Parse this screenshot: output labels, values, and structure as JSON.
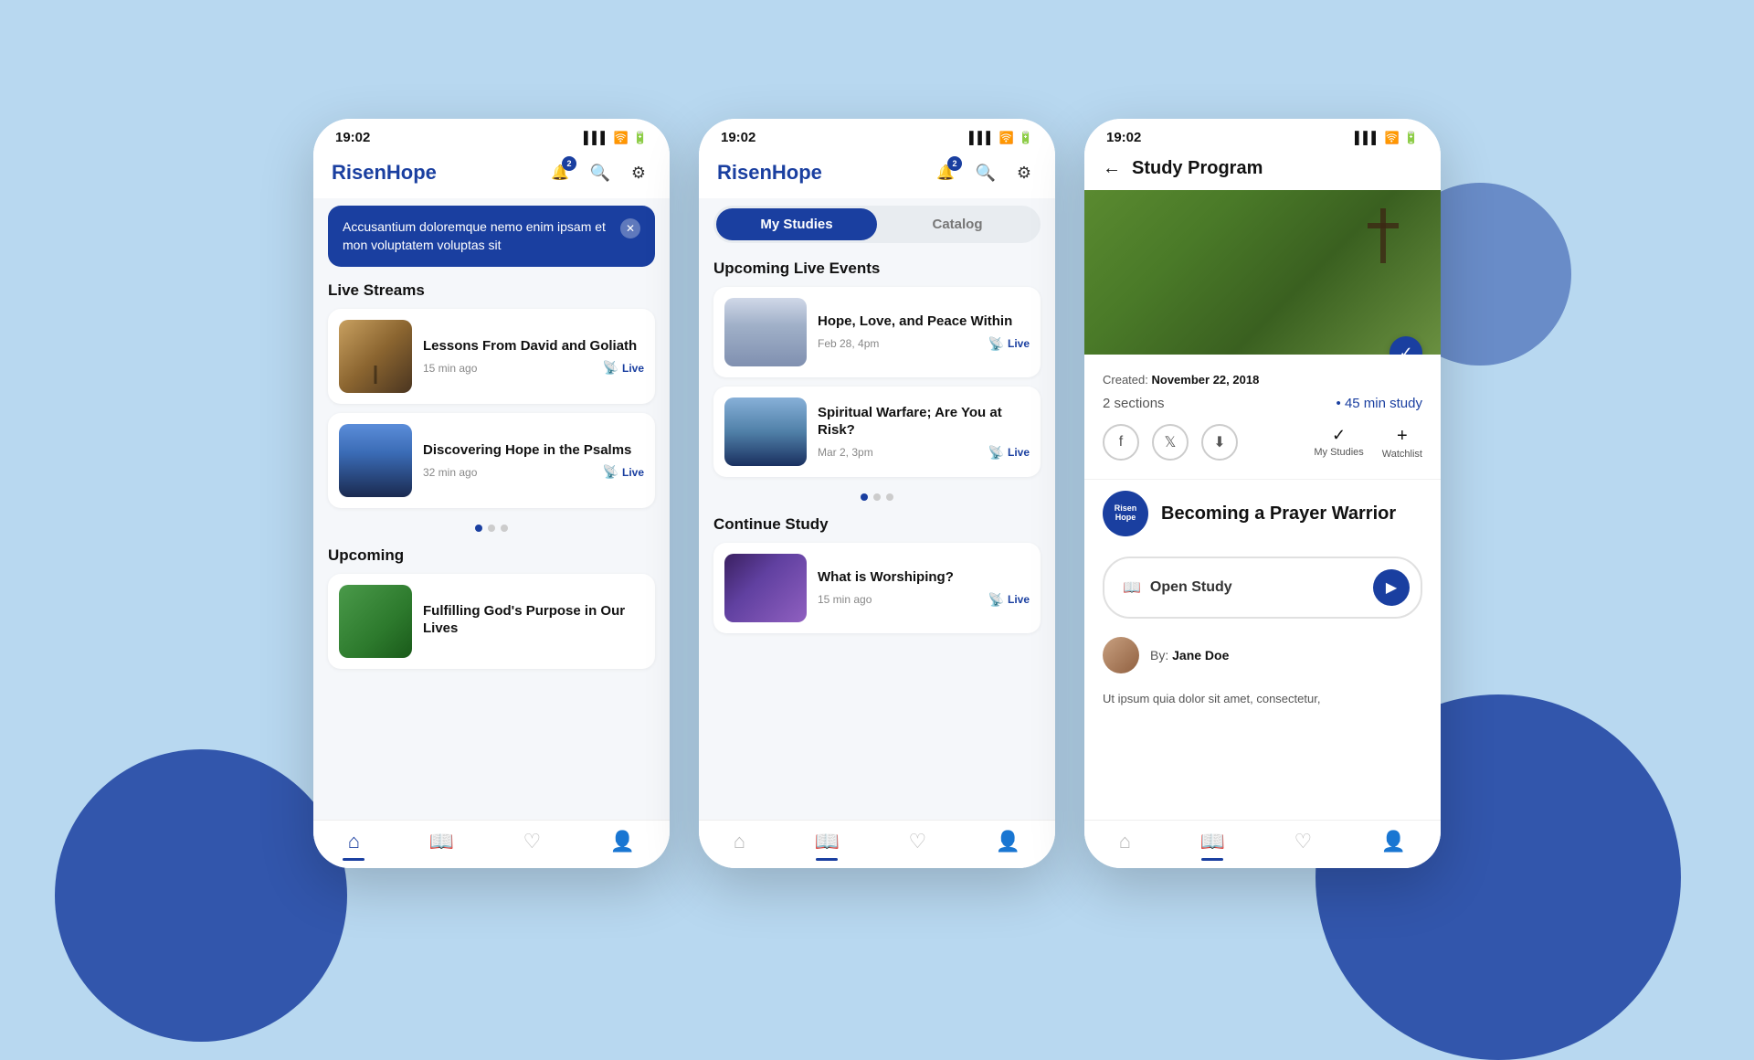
{
  "app": {
    "logo_risen": "Risen",
    "logo_hope": "Hope",
    "time": "19:02",
    "notif_badge": "2"
  },
  "phone1": {
    "banner": {
      "text": "Accusantium doloremque nemo enim ipsam et mon voluptatem voluptas sit"
    },
    "live_streams_title": "Live Streams",
    "streams": [
      {
        "title": "Lessons From David and Goliath",
        "time": "15 min ago",
        "live": "Live"
      },
      {
        "title": "Discovering Hope in the Psalms",
        "time": "32 min ago",
        "live": "Live"
      }
    ],
    "upcoming_title": "Upcoming",
    "upcoming_items": [
      {
        "title": "Fulfilling God's Purpose in Our Lives"
      }
    ]
  },
  "phone2": {
    "tab_my_studies": "My Studies",
    "tab_catalog": "Catalog",
    "live_events_title": "Upcoming Live Events",
    "events": [
      {
        "title": "Hope, Love, and Peace Within",
        "date": "Feb 28, 4pm",
        "live": "Live"
      },
      {
        "title": "Spiritual Warfare; Are You at Risk?",
        "date": "Mar 2, 3pm",
        "live": "Live"
      }
    ],
    "continue_title": "Continue Study",
    "continue_items": [
      {
        "title": "What is Worshiping?",
        "time": "15 min ago",
        "live": "Live"
      }
    ]
  },
  "phone3": {
    "back_label": "←",
    "page_title": "Study Program",
    "created_label": "Created:",
    "created_date": "November 22, 2018",
    "sections": "2 sections",
    "study_time": "45 min study",
    "social_icons": [
      "facebook",
      "twitter",
      "download"
    ],
    "my_studies_label": "My Studies",
    "watchlist_label": "Watchlist",
    "study_title": "Becoming a Prayer Warrior",
    "open_study_label": "Open Study",
    "author_by": "By:",
    "author_name": "Jane Doe",
    "desc": "Ut ipsum quia dolor sit amet, consectetur,"
  },
  "nav": {
    "home": "⌂",
    "book": "📖",
    "heart": "♡",
    "person": "👤"
  }
}
